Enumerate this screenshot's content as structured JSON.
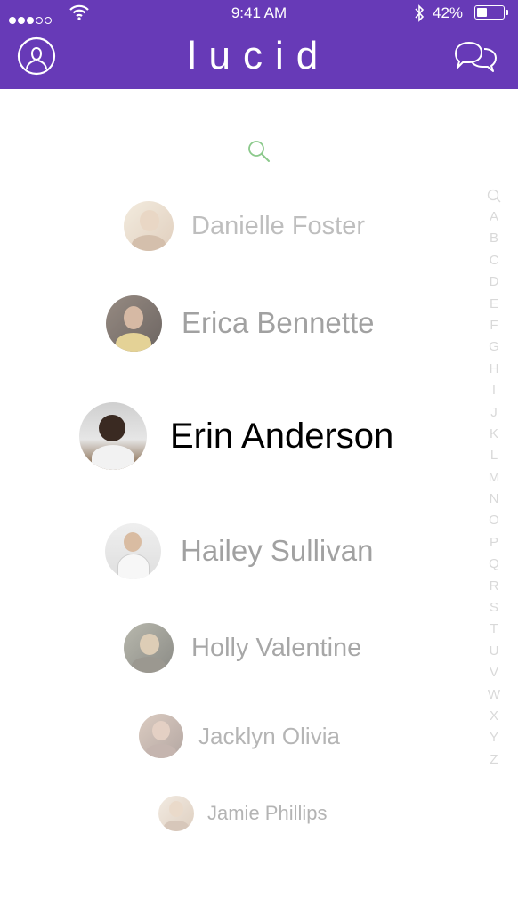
{
  "status_bar": {
    "time": "9:41 AM",
    "battery": "42%",
    "battery_level": 0.42
  },
  "header": {
    "title": "lucid"
  },
  "contacts": [
    {
      "name": "Danielle Foster"
    },
    {
      "name": "Erica Bennette"
    },
    {
      "name": "Erin Anderson"
    },
    {
      "name": "Hailey Sullivan"
    },
    {
      "name": "Holly Valentine"
    },
    {
      "name": "Jacklyn Olivia"
    },
    {
      "name": "Jamie Phillips"
    }
  ],
  "index": [
    "A",
    "B",
    "C",
    "D",
    "E",
    "F",
    "G",
    "H",
    "I",
    "J",
    "K",
    "L",
    "M",
    "N",
    "O",
    "P",
    "Q",
    "R",
    "S",
    "T",
    "U",
    "V",
    "W",
    "X",
    "Y",
    "Z"
  ],
  "colors": {
    "brand": "#673ab7",
    "search_accent": "#8bc98b",
    "selected_text": "#000000",
    "muted_text": "#9e9e9e"
  },
  "icons": {
    "profile": "person-circle-icon",
    "chat": "chat-bubbles-icon",
    "search": "search-icon"
  }
}
